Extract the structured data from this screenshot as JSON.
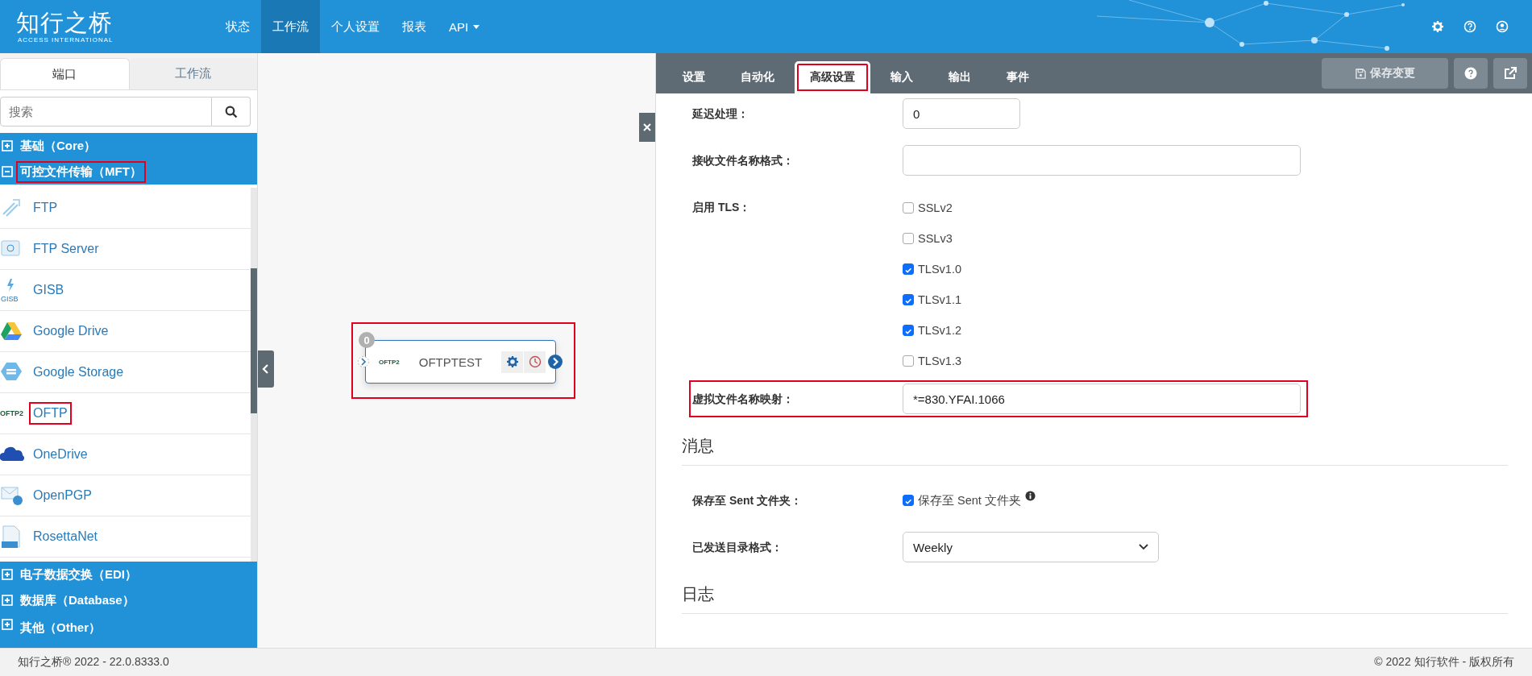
{
  "header": {
    "logo": {
      "title": "知行之桥",
      "subtitle": "ACCESS INTERNATIONAL"
    },
    "nav": [
      {
        "label": "状态",
        "selected": false,
        "dropdown": false
      },
      {
        "label": "工作流",
        "selected": true,
        "dropdown": false
      },
      {
        "label": "个人设置",
        "selected": false,
        "dropdown": false
      },
      {
        "label": "报表",
        "selected": false,
        "dropdown": false
      },
      {
        "label": "API",
        "selected": false,
        "dropdown": true
      }
    ]
  },
  "sidebar": {
    "tabs": [
      {
        "label": "端口",
        "selected": true
      },
      {
        "label": "工作流",
        "selected": false
      }
    ],
    "search": {
      "placeholder": "搜索"
    },
    "groups": [
      {
        "label": "基础（Core）",
        "expanded": false,
        "highlighted": false
      },
      {
        "label": "可控文件传输（MFT）",
        "expanded": true,
        "highlighted": true,
        "children": [
          {
            "label": "FTP",
            "highlighted": false
          },
          {
            "label": "FTP Server",
            "highlighted": false
          },
          {
            "label": "GISB",
            "icon_text": "GISB",
            "highlighted": false
          },
          {
            "label": "Google Drive",
            "highlighted": false
          },
          {
            "label": "Google Storage",
            "highlighted": false
          },
          {
            "label": "OFTP",
            "icon_text": "OFTP2",
            "highlighted": true
          },
          {
            "label": "OneDrive",
            "highlighted": false
          },
          {
            "label": "OpenPGP",
            "highlighted": false
          },
          {
            "label": "RosettaNet",
            "highlighted": false
          }
        ]
      },
      {
        "label": "电子数据交换（EDI）",
        "expanded": false,
        "highlighted": false
      },
      {
        "label": "数据库（Database）",
        "expanded": false,
        "highlighted": false
      },
      {
        "label": "其他（Other）",
        "expanded": false,
        "highlighted": false
      }
    ]
  },
  "canvas": {
    "node": {
      "badge": "0",
      "icon_text": "OFTP2",
      "label": "OFTPTEST",
      "highlighted": true
    }
  },
  "panel": {
    "tabs": [
      {
        "label": "设置",
        "selected": false,
        "highlighted": false
      },
      {
        "label": "自动化",
        "selected": false,
        "highlighted": false
      },
      {
        "label": "高级设置",
        "selected": true,
        "highlighted": true
      },
      {
        "label": "输入",
        "selected": false,
        "highlighted": false
      },
      {
        "label": "输出",
        "selected": false,
        "highlighted": false
      },
      {
        "label": "事件",
        "selected": false,
        "highlighted": false
      }
    ],
    "save_button": {
      "label": "保存变更",
      "disabled": true
    },
    "rows": [
      {
        "kind": "number",
        "label": "延迟处理：",
        "value": "0",
        "highlighted": false
      },
      {
        "kind": "text",
        "label": "接收文件名称格式：",
        "highlighted": false
      },
      {
        "kind": "checkboxes",
        "label": "启用 TLS：",
        "highlighted": false,
        "options": [
          {
            "label": "SSLv2",
            "checked": false
          },
          {
            "label": "SSLv3",
            "checked": false
          },
          {
            "label": "TLSv1.0",
            "checked": true
          },
          {
            "label": "TLSv1.1",
            "checked": true
          },
          {
            "label": "TLSv1.2",
            "checked": true
          },
          {
            "label": "TLSv1.3",
            "checked": false
          }
        ]
      },
      {
        "kind": "text",
        "label": "虚拟文件名称映射：",
        "value": "*=830.YFAI.1066",
        "highlighted": true
      }
    ],
    "sections": [
      {
        "title": "消息",
        "rows": [
          {
            "kind": "checkbox",
            "label": "保存至 Sent 文件夹：",
            "option": {
              "label": "保存至 Sent 文件夹",
              "checked": true
            },
            "info": true
          },
          {
            "kind": "select",
            "label": "已发送目录格式：",
            "value": "Weekly"
          }
        ]
      },
      {
        "title": "日志"
      }
    ]
  },
  "footer": {
    "version": "知行之桥® 2022 - 22.0.8333.0",
    "copyright": "© 2022 知行软件 - 版权所有"
  }
}
